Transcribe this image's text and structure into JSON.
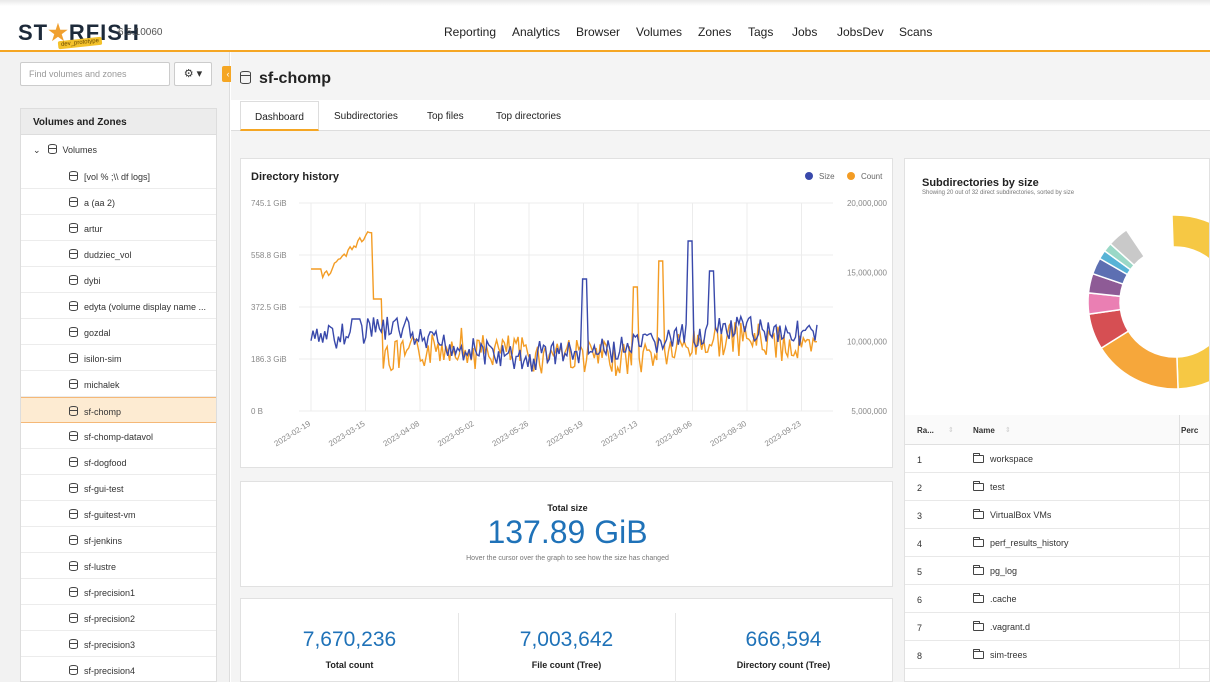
{
  "app": {
    "logo_text_a": "ST",
    "logo_text_star": "★",
    "logo_text_b": "RFISH",
    "logo_tag": "dev_prototype",
    "version": "6.5.10060"
  },
  "nav": [
    "Reporting",
    "Analytics",
    "Browser",
    "Volumes",
    "Zones",
    "Tags",
    "Jobs",
    "JobsDev",
    "Scans"
  ],
  "sidebar": {
    "search_placeholder": "Find volumes and zones",
    "gear_label": "⚙ ▾",
    "collapse_label": "‹",
    "panel_title": "Volumes and Zones",
    "root_label": "Volumes",
    "root_chevron": "⌄",
    "items": [
      "[vol % ;\\\\ df logs]",
      "a (aa 2)",
      "artur",
      "dudziec_vol",
      "dybi",
      "edyta (volume display name ...",
      "gozdal",
      "isilon-sim",
      "michalek",
      "sf-chomp",
      "sf-chomp-datavol",
      "sf-dogfood",
      "sf-gui-test",
      "sf-guitest-vm",
      "sf-jenkins",
      "sf-lustre",
      "sf-precision1",
      "sf-precision2",
      "sf-precision3",
      "sf-precision4"
    ],
    "selected": "sf-chomp"
  },
  "page": {
    "title": "sf-chomp",
    "tabs": [
      "Dashboard",
      "Subdirectories",
      "Top files",
      "Top directories"
    ],
    "active_tab": "Dashboard"
  },
  "history": {
    "title": "Directory history",
    "legend_size": "Size",
    "legend_count": "Count",
    "y_left_ticks": [
      "745.1 GiB",
      "558.8 GiB",
      "372.5 GiB",
      "186.3 GiB",
      "0 B"
    ],
    "y_right_ticks": [
      "20,000,000",
      "15,000,000",
      "10,000,000",
      "5,000,000"
    ],
    "x_ticks": [
      "2023-02-19",
      "2023-03-15",
      "2023-04-08",
      "2023-05-02",
      "2023-05-26",
      "2023-06-19",
      "2023-07-13",
      "2023-08-06",
      "2023-08-30",
      "2023-09-23"
    ],
    "color_size": "#3949ab",
    "color_count": "#f39c24"
  },
  "total": {
    "label": "Total size",
    "value": "137.89 GiB",
    "hint": "Hover the cursor over the graph to see how the size has changed"
  },
  "stats": [
    {
      "value": "7,670,236",
      "label": "Total count"
    },
    {
      "value": "7,003,642",
      "label": "File count (Tree)"
    },
    {
      "value": "666,594",
      "label": "Directory count (Tree)"
    }
  ],
  "subdirs": {
    "title": "Subdirectories by size",
    "subtitle": "Showing 20 out of 32 direct subdirectories, sorted by size",
    "columns": [
      "Ra...",
      "Name",
      "Perc"
    ],
    "rows": [
      {
        "rank": "1",
        "name": "workspace"
      },
      {
        "rank": "2",
        "name": "test"
      },
      {
        "rank": "3",
        "name": "VirtualBox VMs"
      },
      {
        "rank": "4",
        "name": "perf_results_history"
      },
      {
        "rank": "5",
        "name": "pg_log"
      },
      {
        "rank": "6",
        "name": ".cache"
      },
      {
        "rank": "7",
        "name": ".vagrant.d"
      },
      {
        "rank": "8",
        "name": "sim-trees"
      }
    ],
    "donut_colors": [
      "#f6c844",
      "#f6a73b",
      "#d64f53",
      "#ea7fb3",
      "#8e5b96",
      "#5d6fb2",
      "#57b3d6",
      "#9ad8c7",
      "#c9c9c9"
    ]
  }
}
